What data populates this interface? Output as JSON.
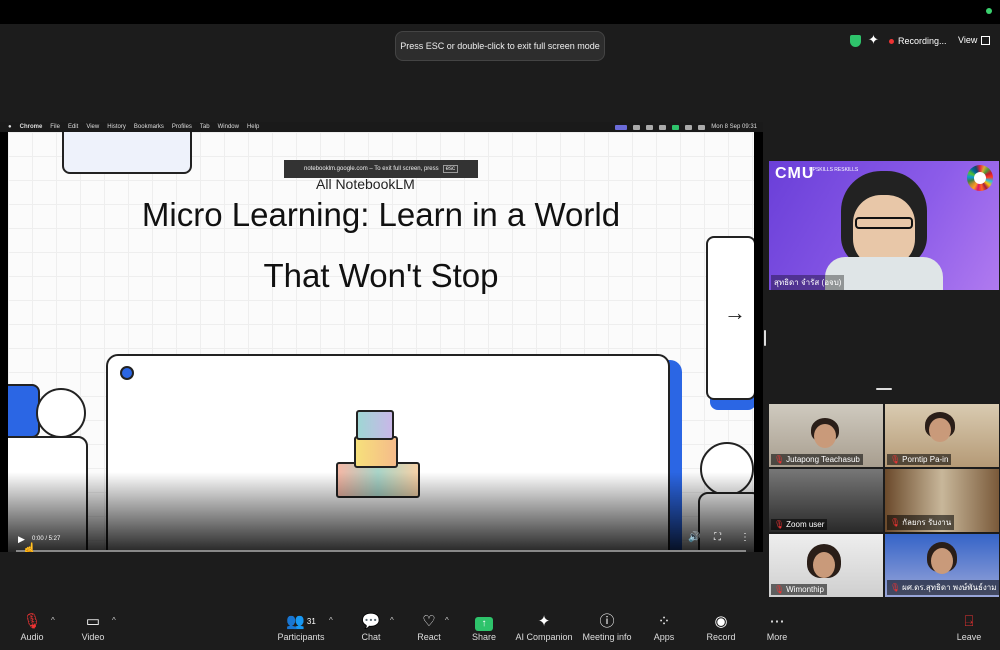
{
  "top": {
    "esc_banner": "Press ESC or double-click to exit full screen mode",
    "recording": "Recording...",
    "view": "View"
  },
  "mac_menu": {
    "items": [
      "Chrome",
      "File",
      "Edit",
      "View",
      "History",
      "Bookmarks",
      "Profiles",
      "Tab",
      "Window",
      "Help"
    ],
    "clock": "Mon 8 Sep  09:31"
  },
  "slide": {
    "fullscreen_tip": "notebooklm.google.com – To exit full screen, press",
    "fullscreen_key": "esc",
    "product": "All NotebookLM",
    "title_line1": "Micro Learning: Learn in a World",
    "title_line2": "That Won't Stop",
    "video_time": "0:00 / 5:27"
  },
  "speaker": {
    "logo": "CMU",
    "logo_sub": "UPSKILLS RESKILLS",
    "name": "สุทธิดา จำรัส (อจบ)"
  },
  "participants": [
    {
      "name": "Jutapong Teachasub"
    },
    {
      "name": "Porntip Pa-in"
    },
    {
      "name": "Zoom user"
    },
    {
      "name": "กัลยกร รับงาน"
    },
    {
      "name": "Wimonthip"
    },
    {
      "name": "ผศ.ดร.สุทธิดา พงษ์พันธ์งาม"
    }
  ],
  "toolbar": {
    "audio": "Audio",
    "video": "Video",
    "participants": "Participants",
    "participant_count": "31",
    "chat": "Chat",
    "react": "React",
    "share": "Share",
    "ai_companion": "AI Companion",
    "meeting_info": "Meeting info",
    "apps": "Apps",
    "record": "Record",
    "more": "More",
    "leave": "Leave"
  },
  "colors": {
    "accent_green": "#2ec36b",
    "record_red": "#e33333",
    "slide_blue": "#2b66e4",
    "speaker_bg": "#8c5ce9"
  }
}
